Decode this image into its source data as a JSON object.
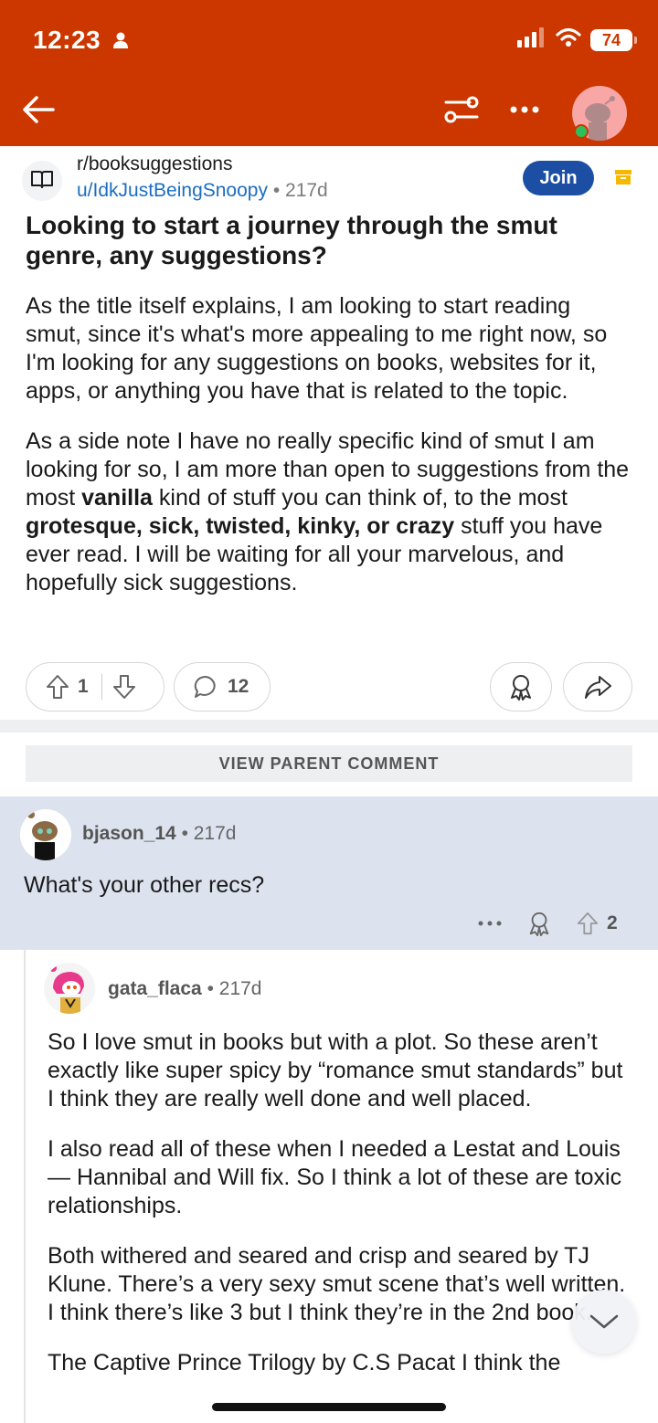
{
  "status_bar": {
    "time": "12:23",
    "battery": "74"
  },
  "colors": {
    "header_bg": "#cc3700",
    "join_bg": "#1c4fa3",
    "author_link": "#1b6ec2",
    "comment_highlight": "#dde3ee"
  },
  "nav": {
    "icons": [
      "back-arrow-icon",
      "filter-icon",
      "more-icon",
      "avatar"
    ]
  },
  "post": {
    "subreddit": "r/booksuggestions",
    "author": "u/IdkJustBeingSnoopy",
    "age": "217d",
    "join_label": "Join",
    "title": "Looking to start a journey through the smut genre, any suggestions?",
    "body_p1": "As the title itself explains, I am looking to start reading smut, since it's what's more appealing to me right now, so I'm looking for any suggestions on books, websites for it, apps, or anything you have that is related to the topic.",
    "body_p2": {
      "t1": "As a side note I have no really specific kind of smut I am looking for so, I am more than open to suggestions from the most ",
      "b1": "vanilla",
      "t2": " kind of stuff you can think of, to the most ",
      "b2": "grotesque, sick, twisted, kinky, or crazy",
      "t3": " stuff you have ever read. I will be waiting for all your marvelous, and hopefully sick suggestions."
    },
    "votes": "1",
    "comments": "12"
  },
  "view_parent_label": "VIEW PARENT COMMENT",
  "comment1": {
    "user": "bjason_14",
    "age": "217d",
    "text": "What's your other recs?",
    "votes": "2"
  },
  "comment2": {
    "user": "gata_flaca",
    "age": "217d",
    "p1": "So I love smut in books but with a plot. So these aren’t exactly like super spicy by “romance smut standards” but I think they are really well done and well placed.",
    "p2": "I also read all of these when I needed a Lestat and Louis— Hannibal and Will fix. So I think a lot of these are toxic relationships.",
    "p3": "Both withered and seared and crisp and seared by TJ Klune. There’s a very sexy smut scene that’s well written. I think there’s like 3 but I think they’re in the 2nd book.",
    "p4": "The Captive Prince Trilogy by C.S Pacat I think the"
  }
}
